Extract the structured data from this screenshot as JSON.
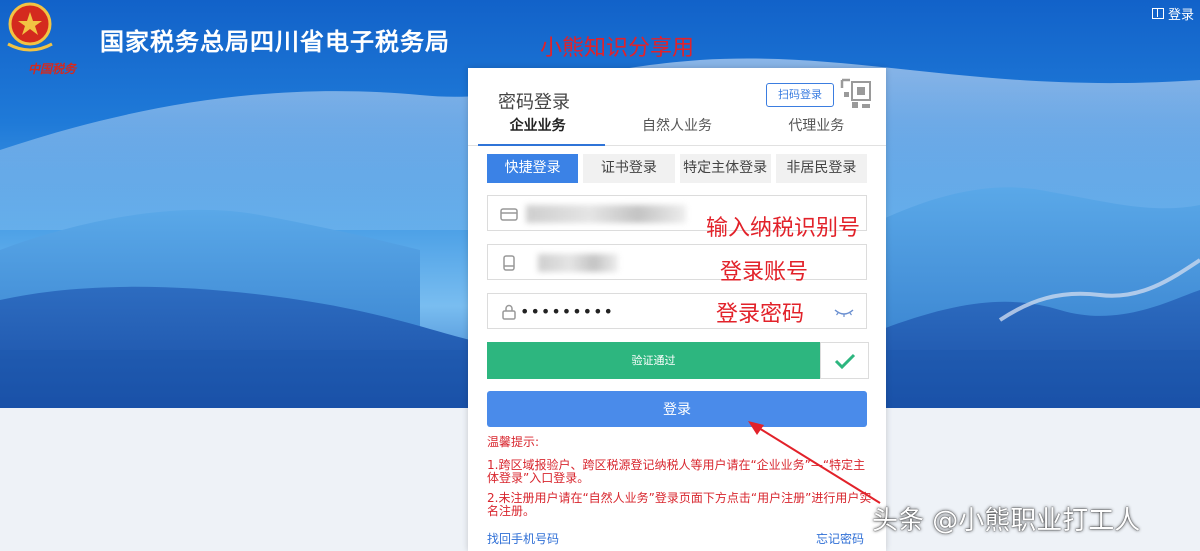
{
  "header": {
    "site_title": "国家税务总局四川省电子税务局",
    "emblem_signature": "中国税务",
    "watermark": "小熊知识分享用",
    "top_login": "登录"
  },
  "login_panel": {
    "title": "密码登录",
    "scan_login": "扫码登录",
    "tabs": [
      {
        "label": "企业业务",
        "active": true
      },
      {
        "label": "自然人业务",
        "active": false
      },
      {
        "label": "代理业务",
        "active": false
      }
    ],
    "subtabs": [
      {
        "label": "快捷登录",
        "active": true
      },
      {
        "label": "证书登录",
        "active": false
      },
      {
        "label": "特定主体登录",
        "active": false
      },
      {
        "label": "非居民登录",
        "active": false
      }
    ],
    "password_mask": "•••••••••",
    "verify_text": "验证通过",
    "login_button": "登录",
    "tips": {
      "title": "温馨提示:",
      "item1": "1.跨区域报验户、跨区税源登记纳税人等用户请在“企业业务”—“特定主体登录”入口登录。",
      "item2": "2.未注册用户请在“自然人业务”登录页面下方点击“用户注册”进行用户实名注册。"
    },
    "retrieve_phone": "找回手机号码",
    "forgot_password": "忘记密码"
  },
  "annotations": {
    "taxpayer_id": "输入纳税识别号",
    "account": "登录账号",
    "password": "登录密码"
  },
  "watermark_bottom": "头条 @小熊职业打工人",
  "colors": {
    "accent_blue": "#3b82e6",
    "verify_green": "#2db67f",
    "annotation_red": "#e2222a"
  }
}
